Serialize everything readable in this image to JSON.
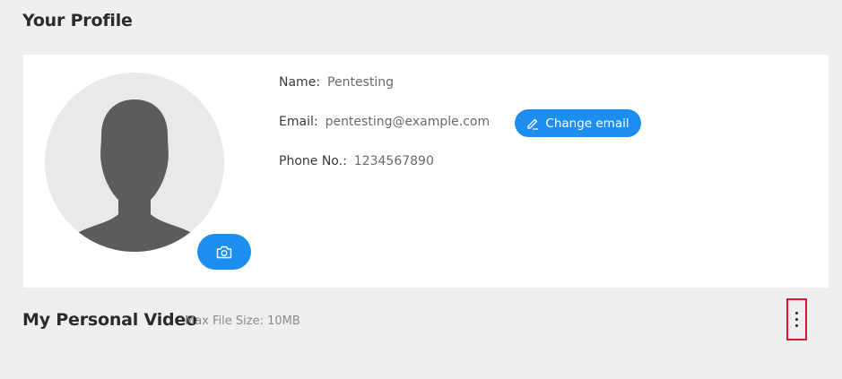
{
  "page": {
    "title": "Your Profile"
  },
  "profile": {
    "name_label": "Name",
    "name_value": "Pentesting",
    "email_label": "Email",
    "email_value": "pentesting@example.com",
    "phone_label": "Phone No.",
    "phone_value": "1234567890",
    "colon": ":",
    "change_email_label": "Change email"
  },
  "icons": {
    "avatar": "person-silhouette-icon",
    "camera": "camera-icon",
    "edit": "pencil-icon",
    "more": "vertical-dots-icon"
  },
  "video": {
    "title": "My Personal Video",
    "max_size": "Max File Size: 10MB"
  },
  "colors": {
    "accent": "#1e8df0",
    "background": "#efeff2",
    "highlight_border": "#d11f2a",
    "avatar_bg": "#e8e9eb",
    "avatar_fg": "#5c5c5e"
  }
}
